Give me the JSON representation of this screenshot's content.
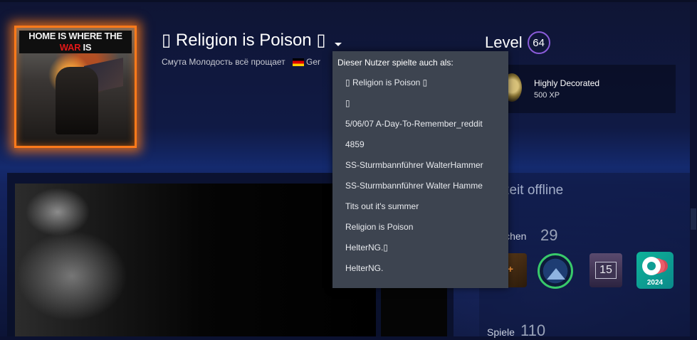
{
  "profile": {
    "persona_name": "▯ Religion is Poison ▯",
    "real_name": "Смута Молодость всё прощает",
    "country": "Ger",
    "avatar_text_white": "HOME IS WHERE THE ",
    "avatar_text_red": "WAR",
    "avatar_text_end": " IS"
  },
  "level": {
    "label": "Level",
    "value": "64"
  },
  "featured_badge": {
    "name": "Highly Decorated",
    "xp": "500 XP"
  },
  "alias_menu": {
    "title": "Dieser Nutzer spielte auch als:",
    "items": [
      "▯ Religion is Poison ▯",
      "▯",
      "5/06/07 A-Day-To-Remember_reddit",
      "4859",
      "SS-Sturmbannführer WalterHammer",
      "SS-Sturmbannführer Walter Hamme",
      "Tits out it's summer",
      "Religion is Poison",
      "HelterNG.▯",
      "HelterNG."
    ]
  },
  "sidebar": {
    "status": "zeit offline",
    "badges_label": "ichen",
    "badges_count": "29",
    "games_label": "Spiele",
    "games_count": "110",
    "badges": [
      {
        "icon": "level-badge-icon",
        "text": "0+"
      },
      {
        "icon": "mountain-badge-icon"
      },
      {
        "icon": "years-badge-icon",
        "text": "15"
      },
      {
        "icon": "steam-2024-badge-icon",
        "text": "2024"
      }
    ]
  },
  "colors": {
    "level_ring": "#8a5bd9",
    "avatar_frame": "#ff7a1a",
    "menu_bg": "#3d4450"
  }
}
